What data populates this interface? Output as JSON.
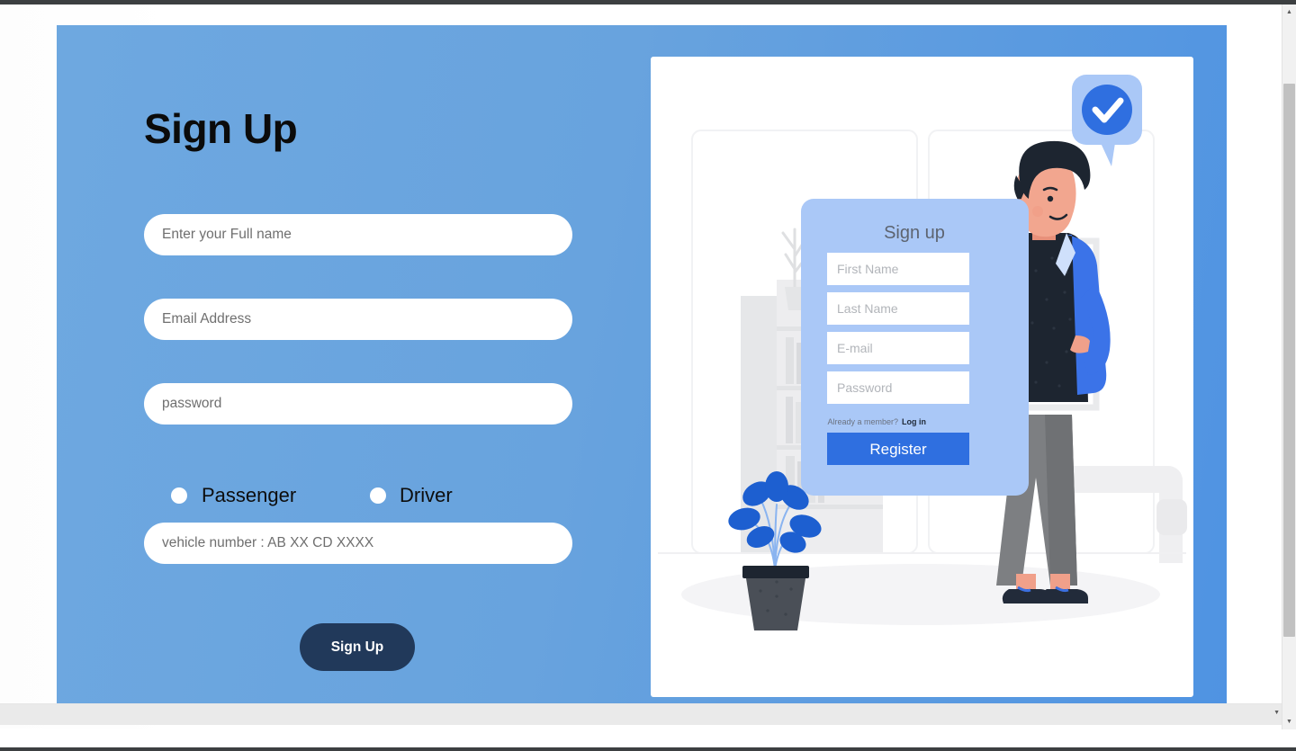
{
  "page": {
    "title": "Sign Up",
    "background_accent": "#68a3de",
    "submit_button_color": "#21395a"
  },
  "form": {
    "fields": [
      {
        "name": "fullname",
        "placeholder": "Enter your Full name",
        "value": ""
      },
      {
        "name": "email",
        "placeholder": "Email Address",
        "value": ""
      },
      {
        "name": "password",
        "placeholder": "password",
        "value": ""
      },
      {
        "name": "vehicle",
        "placeholder": "vehicle number : AB XX CD XXXX",
        "value": ""
      }
    ],
    "role_options": [
      {
        "label": "Passenger",
        "selected": false
      },
      {
        "label": "Driver",
        "selected": false
      }
    ],
    "submit_label": "Sign Up"
  },
  "illustration": {
    "card_title": "Sign up",
    "fields": [
      {
        "placeholder": "First Name"
      },
      {
        "placeholder": "Last Name"
      },
      {
        "placeholder": "E-mail"
      },
      {
        "placeholder": "Password"
      }
    ],
    "login_prompt": "Already a member?",
    "login_link": "Log in",
    "register_label": "Register",
    "register_color": "#2f6fe0",
    "panel_color": "#aac8f7",
    "badge_icon": "check-circle-icon"
  },
  "chrome": {
    "scroll_up_icon": "▲",
    "scroll_down_icon": "▼",
    "hscroll_arrow_icon": "▼"
  }
}
